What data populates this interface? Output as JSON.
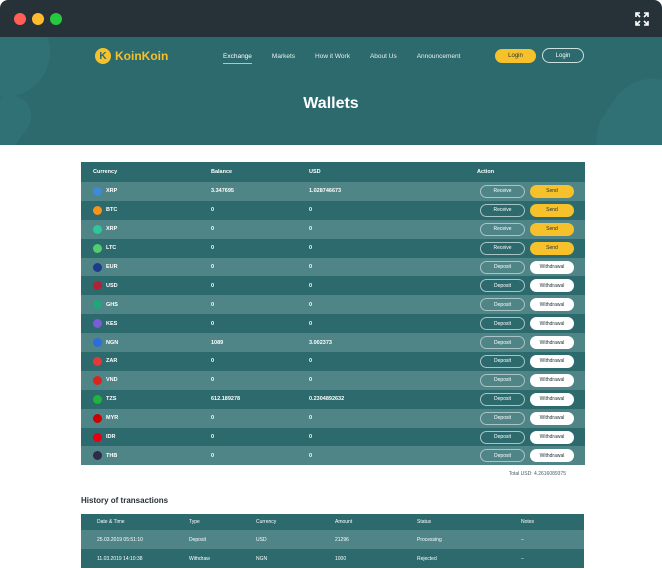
{
  "brand": {
    "name": "KoinKoin",
    "coin_glyph": "K",
    "accent": "#f6c12a",
    "primary": "#2c6a6d"
  },
  "nav": [
    {
      "label": "Exchange",
      "active": true
    },
    {
      "label": "Markets"
    },
    {
      "label": "How it Work"
    },
    {
      "label": "About Us"
    },
    {
      "label": "Announcement"
    }
  ],
  "header": {
    "login_primary": "Login",
    "login_secondary": "Login"
  },
  "page_title": "Wallets",
  "wallet_table": {
    "headers": {
      "currency": "Currency",
      "balance": "Balance",
      "usd": "USD",
      "action": "Action"
    },
    "rows": [
      {
        "currency": "XRP",
        "balance": "3.347695",
        "usd": "1.028746673",
        "icon_color": "#3d8bd8",
        "icon": "xrp-icon",
        "action": "send"
      },
      {
        "currency": "BTC",
        "balance": "0",
        "usd": "0",
        "icon_color": "#f7931a",
        "icon": "btc-icon",
        "action": "send"
      },
      {
        "currency": "XRP",
        "balance": "0",
        "usd": "0",
        "icon_color": "#2fc69a",
        "icon": "xrp-icon",
        "action": "send"
      },
      {
        "currency": "LTC",
        "balance": "0",
        "usd": "0",
        "icon_color": "#4fcf6e",
        "icon": "ltc-icon",
        "action": "send"
      },
      {
        "currency": "EUR",
        "balance": "0",
        "usd": "0",
        "icon_color": "#1e3a8a",
        "icon": "eu-flag-icon",
        "action": "withdraw"
      },
      {
        "currency": "USD",
        "balance": "0",
        "usd": "0",
        "icon_color": "#b22234",
        "icon": "us-flag-icon",
        "action": "withdraw"
      },
      {
        "currency": "GHS",
        "balance": "0",
        "usd": "0",
        "icon_color": "#1fa67a",
        "icon": "ghs-icon",
        "action": "withdraw"
      },
      {
        "currency": "KES",
        "balance": "0",
        "usd": "0",
        "icon_color": "#7b5cd6",
        "icon": "kes-icon",
        "action": "withdraw"
      },
      {
        "currency": "NGN",
        "balance": "1089",
        "usd": "3.002373",
        "icon_color": "#2d6cdf",
        "icon": "ngn-icon",
        "action": "withdraw"
      },
      {
        "currency": "ZAR",
        "balance": "0",
        "usd": "0",
        "icon_color": "#e53935",
        "icon": "zar-icon",
        "action": "withdraw"
      },
      {
        "currency": "VND",
        "balance": "0",
        "usd": "0",
        "icon_color": "#da251d",
        "icon": "vn-flag-icon",
        "action": "withdraw"
      },
      {
        "currency": "TZS",
        "balance": "612.189278",
        "usd": "0.2304892632",
        "icon_color": "#1eb53a",
        "icon": "tz-flag-icon",
        "action": "withdraw"
      },
      {
        "currency": "MYR",
        "balance": "0",
        "usd": "0",
        "icon_color": "#cc0001",
        "icon": "my-flag-icon",
        "action": "withdraw"
      },
      {
        "currency": "IDR",
        "balance": "0",
        "usd": "0",
        "icon_color": "#e70011",
        "icon": "id-flag-icon",
        "action": "withdraw"
      },
      {
        "currency": "THB",
        "balance": "0",
        "usd": "0",
        "icon_color": "#2d2a4a",
        "icon": "th-flag-icon",
        "action": "withdraw"
      }
    ],
    "labels": {
      "receive": "Receive",
      "send": "Send",
      "deposit": "Deposit",
      "withdrawal": "Withdrawal"
    },
    "total": "Total USD: 4.2616089375"
  },
  "history": {
    "title": "History of transactions",
    "headers": [
      "Date & Time",
      "Type",
      "Currency",
      "Amount",
      "Status",
      "Notes"
    ],
    "rows": [
      [
        "25.03.2019 05:51:10",
        "Deposit",
        "USD",
        "21296",
        "Processing",
        "–"
      ],
      [
        "11.03.2019 14:10:38",
        "Withdraw",
        "NGN",
        "1000",
        "Rejected",
        "–"
      ]
    ]
  }
}
